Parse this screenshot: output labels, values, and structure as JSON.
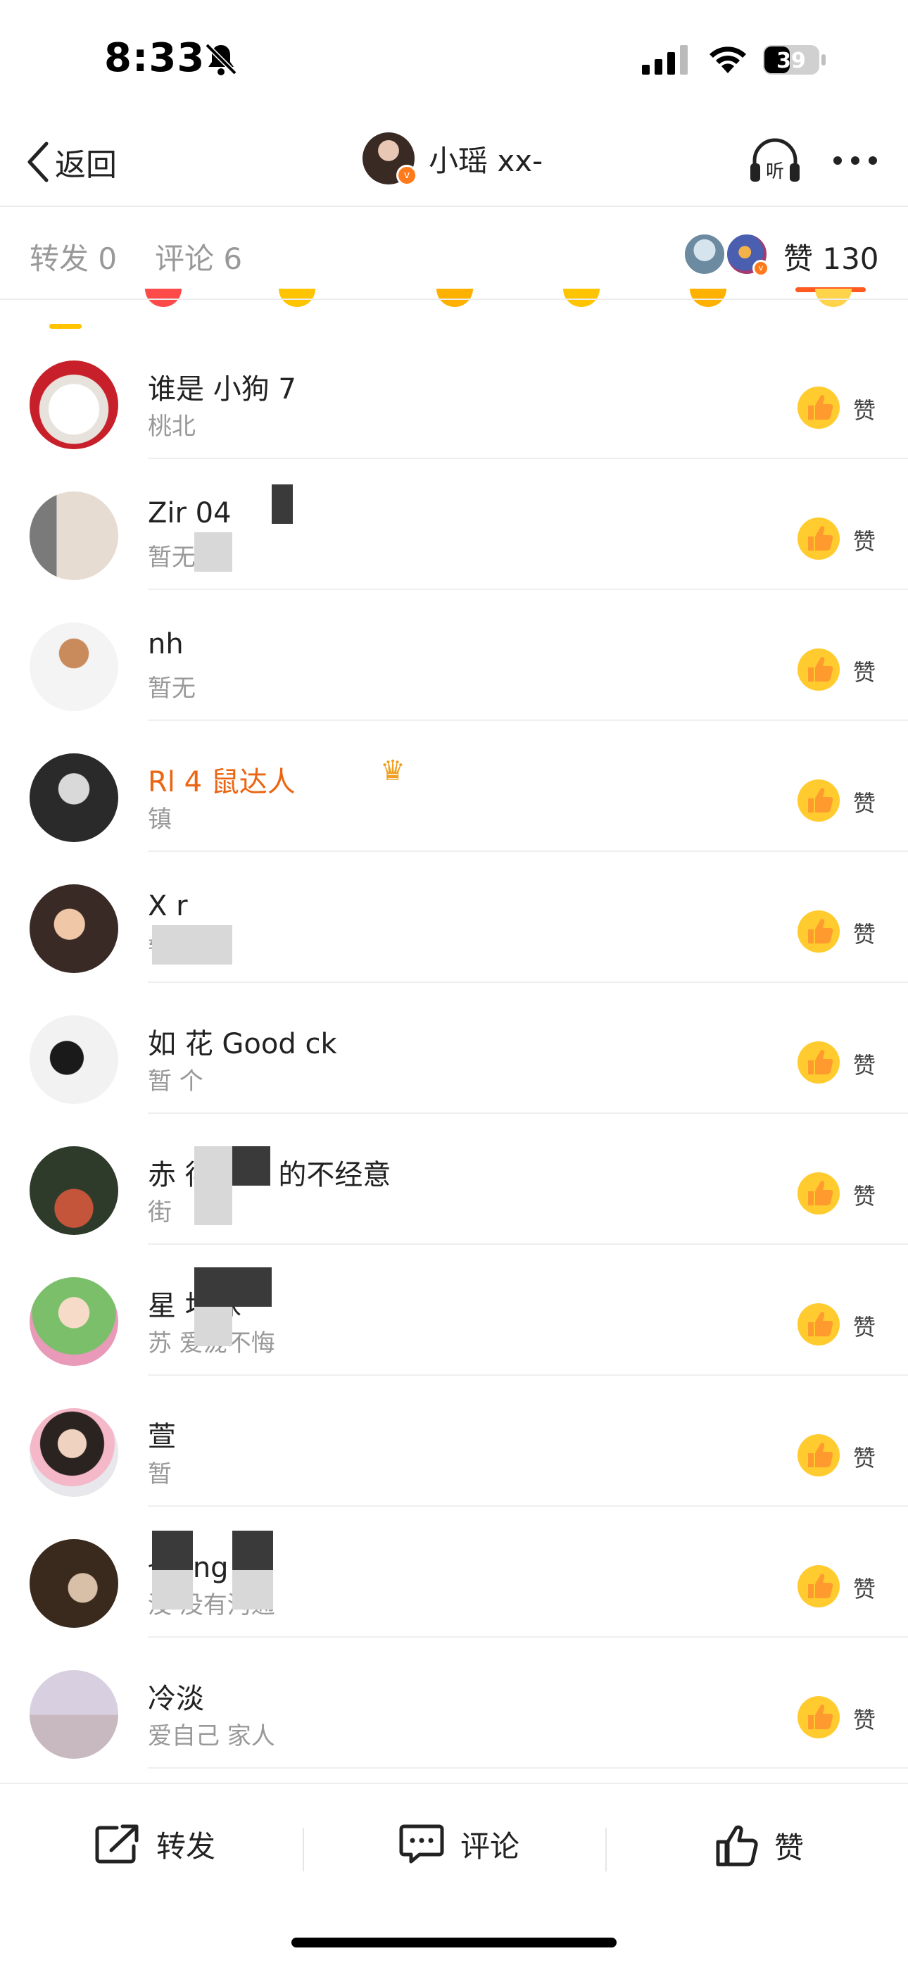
{
  "status_bar": {
    "time": "8:33",
    "battery": "39"
  },
  "nav": {
    "back_label": "返回",
    "title": "小瑶 xx-"
  },
  "tabs": {
    "repost": "转发 0",
    "comment": "评论 6",
    "like": "赞 130"
  },
  "likers": [
    {
      "name": "谁是            小狗 7",
      "desc": "桃北"
    },
    {
      "name": "Zir            04",
      "desc": "暂无"
    },
    {
      "name": "nh",
      "desc": "暂无"
    },
    {
      "name": "Rl    4     鼠达人",
      "desc": "镇",
      "highlight": true,
      "badge": "crown"
    },
    {
      "name": "X           r",
      "desc": "暂"
    },
    {
      "name": "如      花       Good   ck",
      "desc": "暂   个"
    },
    {
      "name": "赤      得了七    的不经意",
      "desc": "街"
    },
    {
      "name": "星           地球",
      "desc": "苏            爱泷不悔"
    },
    {
      "name": "萱",
      "desc": "暂"
    },
    {
      "name": "也          ing",
      "desc": "没           没有沟通"
    },
    {
      "name": "冷淡",
      "desc": "爱自己         家人"
    }
  ],
  "like_action_label": "赞",
  "bottom_bar": {
    "repost": "转发",
    "comment": "评论",
    "like": "赞"
  }
}
